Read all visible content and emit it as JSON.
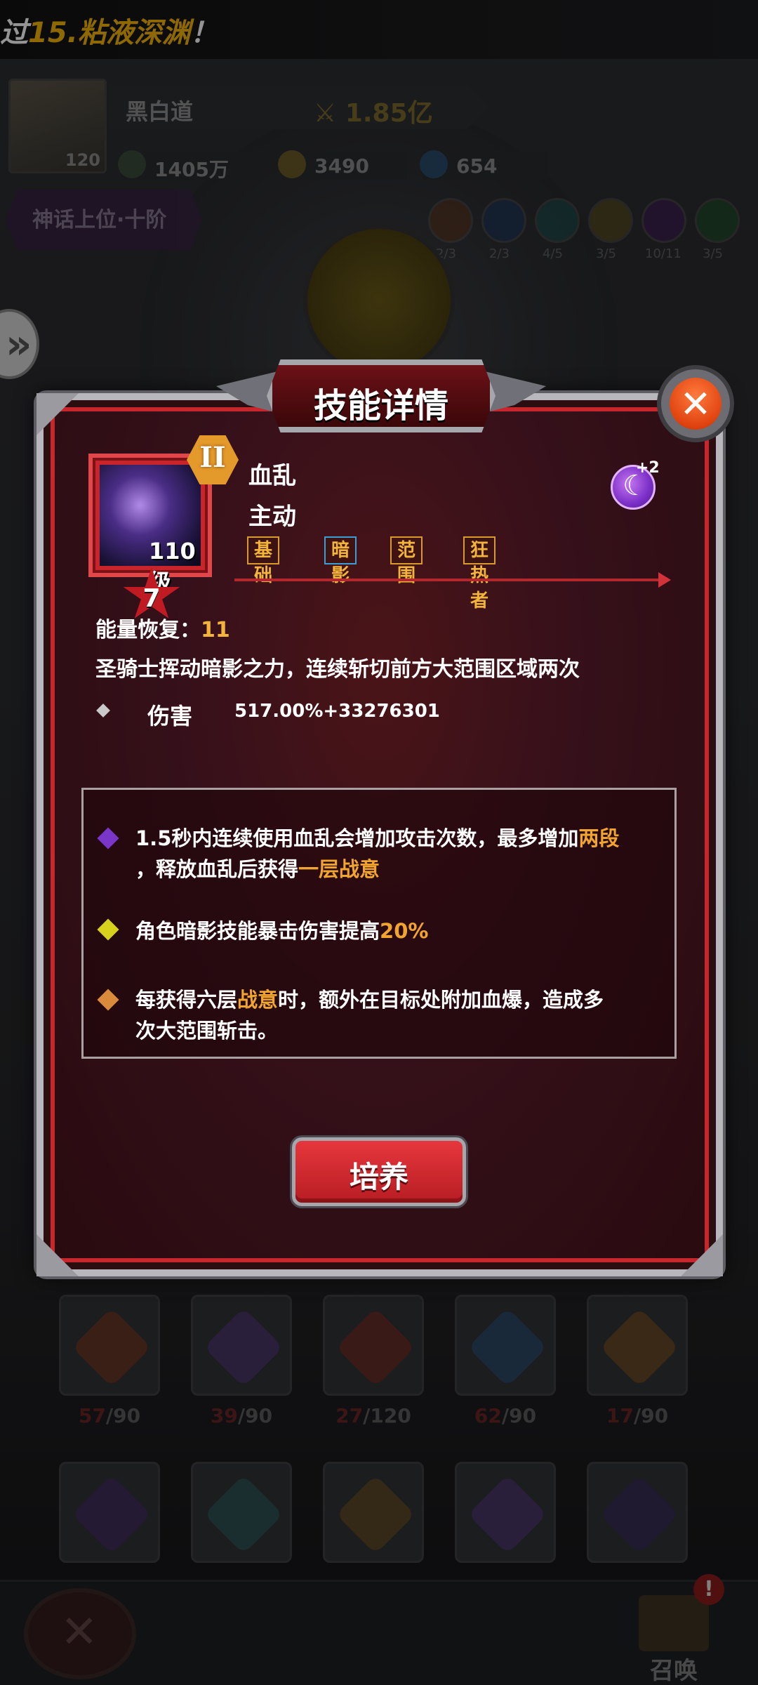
{
  "banner": {
    "prefix": "过",
    "highlight": "15.粘液深渊",
    "suffix": "！"
  },
  "player": {
    "level": "120",
    "name": "黑白道",
    "power": "1.85亿",
    "resources": [
      {
        "icon": "gem-coin-icon",
        "value": "1405万"
      },
      {
        "icon": "gold-coin-icon",
        "value": "3490"
      },
      {
        "icon": "crystal-icon",
        "value": "654"
      }
    ],
    "rank": "神话上位·十阶"
  },
  "elements": [
    {
      "icon": "fire-element-icon",
      "count": "2/3",
      "color": "#c2551f"
    },
    {
      "icon": "ice-element-icon",
      "count": "2/3",
      "color": "#2e6bc2"
    },
    {
      "icon": "frost-element-icon",
      "count": "4/5",
      "color": "#1e9aa8"
    },
    {
      "icon": "light-element-icon",
      "count": "3/5",
      "color": "#c29a1f"
    },
    {
      "icon": "shadow-element-icon",
      "count": "10/11",
      "color": "#7a2fc2"
    },
    {
      "icon": "nature-element-icon",
      "count": "3/5",
      "color": "#3a9a3a"
    }
  ],
  "modal": {
    "title": "技能详情",
    "close_icon": "close-icon",
    "skill": {
      "rank": "II",
      "level": "110级",
      "stars": "7",
      "name": "血乱",
      "type": "主动",
      "tags": [
        "基础",
        "暗影",
        "范围",
        "狂热者"
      ],
      "rune_plus": "+2",
      "energy_label": "能量恢复：",
      "energy_value": "11",
      "description": "圣骑士挥动暗影之力，连续斩切前方大范围区域两次",
      "damage_label": "伤害",
      "damage_value": "517.00%+33276301"
    },
    "effects": [
      {
        "color": "#7a35c9",
        "line1_a": "1.5秒内连续使用血乱会增加攻击次数，最多增加",
        "line1_hl": "两段",
        "line2_a": "，释放血乱后获得",
        "line2_hl": "一层战意",
        "line2_b": ""
      },
      {
        "color": "#d8d21c",
        "line1_a": "角色暗影技能暴击伤害提高",
        "line1_hl": "20%",
        "line1_b": ""
      },
      {
        "color": "#d98a3a",
        "line1_a": "每获得六层",
        "line1_hl": "战意",
        "line1_b": "时，额外在目标处附加血爆，造成多",
        "line2_a": "次大范围斩击。"
      }
    ],
    "train_label": "培养"
  },
  "skill_grid": {
    "row1": [
      {
        "icon": "flame-slash-skill-icon",
        "cur": "57",
        "max": "/90",
        "color": "#8a3a1a"
      },
      {
        "icon": "shadow-claw-skill-icon",
        "cur": "39",
        "max": "/90",
        "color": "#5a3a8a"
      },
      {
        "icon": "fire-runner-skill-icon",
        "cur": "27",
        "max": "/120",
        "color": "#8a2a1a"
      },
      {
        "icon": "ice-crown-skill-icon",
        "cur": "62",
        "max": "/90",
        "color": "#2a5a8a"
      },
      {
        "icon": "gold-rune-skill-icon",
        "cur": "17",
        "max": "/90",
        "color": "#8a5a1a"
      }
    ],
    "row2": [
      {
        "icon": "dark-figure-skill-icon",
        "color": "#4a2a7a"
      },
      {
        "icon": "eye-skill-icon",
        "color": "#2a6a6a"
      },
      {
        "icon": "golden-flame-skill-icon",
        "color": "#7a5a1a"
      },
      {
        "icon": "star-burst-skill-icon",
        "color": "#5a3a8a"
      },
      {
        "icon": "void-orb-skill-icon",
        "color": "#3a2a6a"
      }
    ]
  },
  "bottom": {
    "close_icon": "close-icon",
    "summon_label": "召唤",
    "summon_alert": "!"
  }
}
